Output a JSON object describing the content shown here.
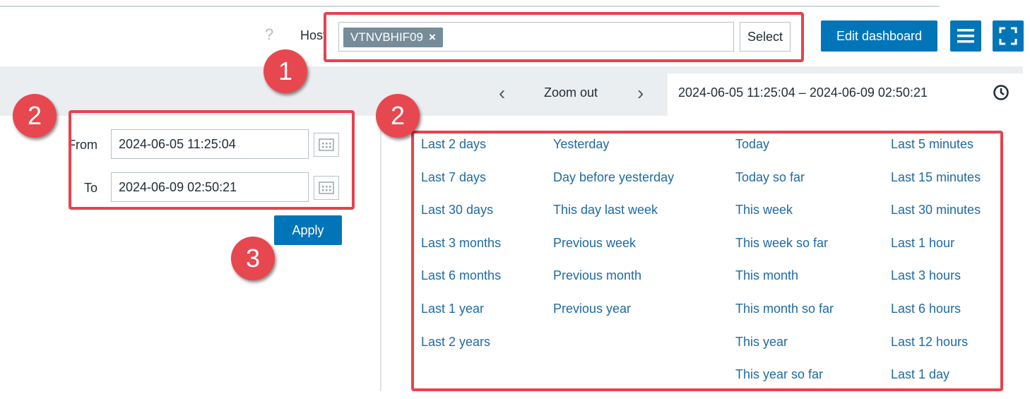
{
  "header": {
    "help": "?",
    "host_label": "Host",
    "host_chip": "VTNVBHIF09",
    "host_chip_remove": "×",
    "select_label": "Select",
    "edit_dashboard_label": "Edit dashboard"
  },
  "timebar": {
    "zoom_out_label": "Zoom out",
    "range_text": "2024-06-05 11:25:04 – 2024-06-09 02:50:21"
  },
  "time_inputs": {
    "from_label": "From",
    "from_value": "2024-06-05 11:25:04",
    "to_label": "To",
    "to_value": "2024-06-09 02:50:21",
    "apply_label": "Apply"
  },
  "quick_ranges": {
    "col1": [
      "Last 2 days",
      "Last 7 days",
      "Last 30 days",
      "Last 3 months",
      "Last 6 months",
      "Last 1 year",
      "Last 2 years"
    ],
    "col2": [
      "Yesterday",
      "Day before yesterday",
      "This day last week",
      "Previous week",
      "Previous month",
      "Previous year"
    ],
    "col3": [
      "Today",
      "Today so far",
      "This week",
      "This week so far",
      "This month",
      "This month so far",
      "This year",
      "This year so far"
    ],
    "col4": [
      "Last 5 minutes",
      "Last 15 minutes",
      "Last 30 minutes",
      "Last 1 hour",
      "Last 3 hours",
      "Last 6 hours",
      "Last 12 hours",
      "Last 1 day"
    ]
  },
  "annotations": {
    "badge1": "1",
    "badge2_left": "2",
    "badge2_right": "2",
    "badge3": "3",
    "highlight_color": "#e6424d"
  },
  "colors": {
    "accent": "#0275b8",
    "link": "#1f6aa3",
    "chip": "#768d99"
  }
}
